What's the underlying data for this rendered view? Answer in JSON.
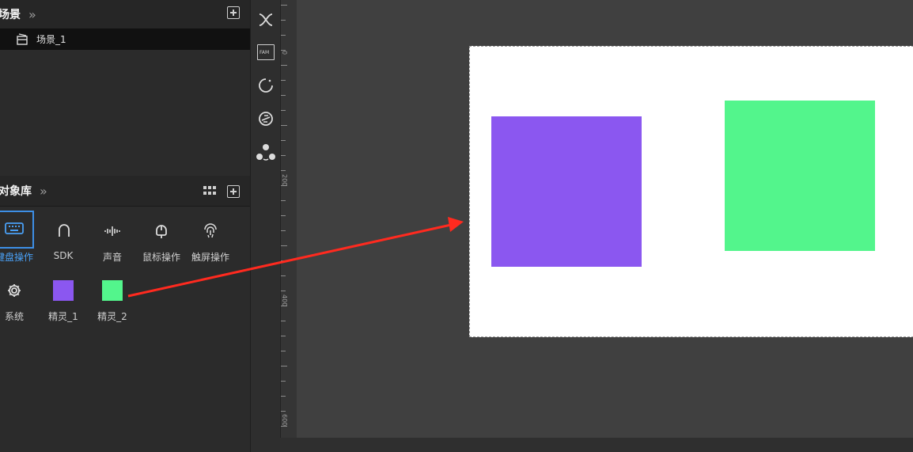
{
  "scene_panel": {
    "title": "场景",
    "items": [
      {
        "label": "场景_1"
      }
    ]
  },
  "library_panel": {
    "title": "对象库",
    "items": [
      {
        "label": "键盘操作",
        "icon": "keyboard-icon",
        "selected": true
      },
      {
        "label": "SDK",
        "icon": "sdk-icon"
      },
      {
        "label": "声音",
        "icon": "sound-wave-icon"
      },
      {
        "label": "鼠标操作",
        "icon": "mouse-icon"
      },
      {
        "label": "触屏操作",
        "icon": "fingerprint-icon"
      },
      {
        "label": "系统",
        "icon": "gear-icon"
      },
      {
        "label": "精灵_1",
        "icon": "sprite-thumb",
        "color": "#8b57f0"
      },
      {
        "label": "精灵_2",
        "icon": "sprite-thumb",
        "color": "#53f58c"
      }
    ]
  },
  "toolbar": {
    "fam_label": "FAM",
    "icons": [
      "shuffle-icon",
      "folder-fam-icon",
      "refresh-icon",
      "no-sync-icon",
      "share-icon"
    ]
  },
  "ruler": {
    "labels": [
      "0",
      "200",
      "400",
      "600"
    ]
  },
  "stage": {
    "background": "#ffffff",
    "sprites": [
      {
        "name": "精灵_1",
        "color": "#8b57f0"
      },
      {
        "name": "精灵_2",
        "color": "#53f58c"
      }
    ]
  },
  "annotation": {
    "arrow_color": "#ff2a1f"
  },
  "colors": {
    "accent": "#3d8fe6"
  }
}
